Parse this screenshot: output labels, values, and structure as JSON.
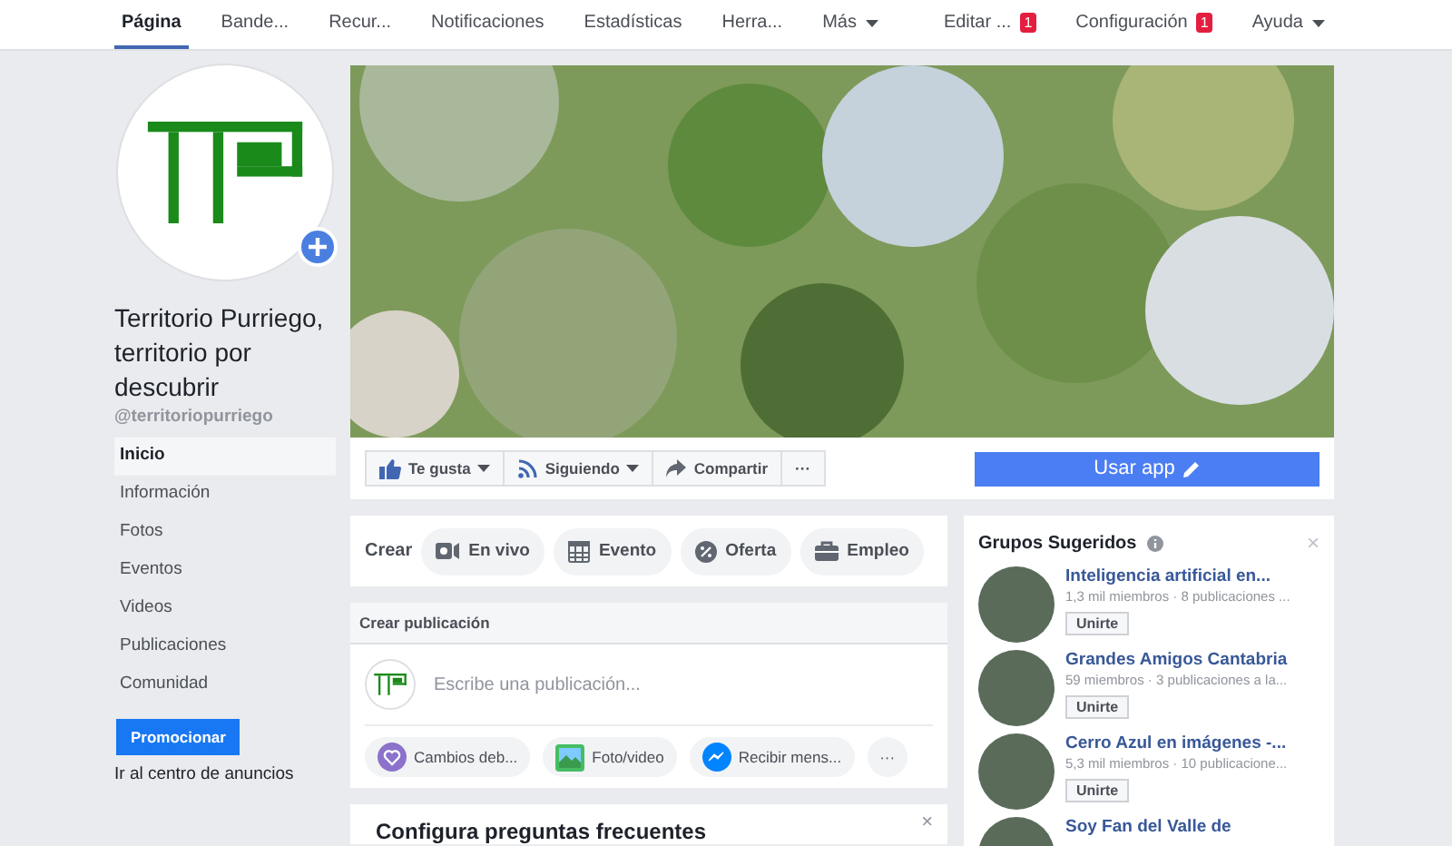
{
  "top_nav": {
    "tabs": [
      {
        "label": "Página",
        "selected": true,
        "caret": false
      },
      {
        "label": "Bande...",
        "selected": false,
        "caret": false
      },
      {
        "label": "Recur...",
        "selected": false,
        "caret": false
      },
      {
        "label": "Notificaciones",
        "selected": false,
        "caret": false
      },
      {
        "label": "Estadísticas",
        "selected": false,
        "caret": false
      },
      {
        "label": "Herra...",
        "selected": false,
        "caret": false
      },
      {
        "label": "Más",
        "selected": false,
        "caret": true
      }
    ],
    "right": [
      {
        "label": "Editar ...",
        "badge": "1",
        "caret": false
      },
      {
        "label": "Configuración",
        "badge": "1",
        "caret": false
      },
      {
        "label": "Ayuda",
        "caret": true
      }
    ]
  },
  "profile": {
    "name": "Territorio Purriego, territorio por descubrir",
    "handle": "@territoriopurriego"
  },
  "sidebar": {
    "items": [
      {
        "label": "Inicio",
        "selected": true
      },
      {
        "label": "Información",
        "selected": false
      },
      {
        "label": "Fotos",
        "selected": false
      },
      {
        "label": "Eventos",
        "selected": false
      },
      {
        "label": "Videos",
        "selected": false
      },
      {
        "label": "Publicaciones",
        "selected": false
      },
      {
        "label": "Comunidad",
        "selected": false
      }
    ],
    "promote_button": "Promocionar",
    "ads_link": "Ir al centro de anuncios"
  },
  "actions": [
    {
      "kind": "like",
      "label": "Te gusta",
      "caret": true
    },
    {
      "kind": "follow",
      "label": "Siguiendo",
      "caret": true
    },
    {
      "kind": "share",
      "label": "Compartir",
      "caret": false
    },
    {
      "kind": "more",
      "label": "···",
      "caret": false
    }
  ],
  "use_app_button": "Usar app",
  "create": {
    "label": "Crear",
    "items": [
      {
        "kind": "live",
        "label": "En vivo"
      },
      {
        "kind": "event",
        "label": "Evento"
      },
      {
        "kind": "offer",
        "label": "Oferta"
      },
      {
        "kind": "job",
        "label": "Empleo"
      }
    ]
  },
  "composer": {
    "title": "Crear publicación",
    "placeholder": "Escribe una publicación...",
    "chips": [
      {
        "kind": "heart",
        "label": "Cambios deb..."
      },
      {
        "kind": "photo",
        "label": "Foto/video"
      },
      {
        "kind": "messenger",
        "label": "Recibir mens..."
      },
      {
        "kind": "more",
        "label": "···"
      }
    ]
  },
  "faq_card": {
    "title": "Configura preguntas frecuentes",
    "close": "×"
  },
  "groups": {
    "title": "Grupos Sugeridos",
    "close": "×",
    "items": [
      {
        "name": "Inteligencia artificial en...",
        "meta": "1,3 mil miembros · 8 publicaciones ...",
        "button": "Unirte"
      },
      {
        "name": "Grandes Amigos Cantabria",
        "meta": "59 miembros · 3 publicaciones a la...",
        "button": "Unirte"
      },
      {
        "name": "Cerro Azul en imágenes -...",
        "meta": "5,3 mil miembros · 10 publicacione...",
        "button": "Unirte"
      },
      {
        "name": "Soy Fan del Valle de"
      }
    ]
  }
}
